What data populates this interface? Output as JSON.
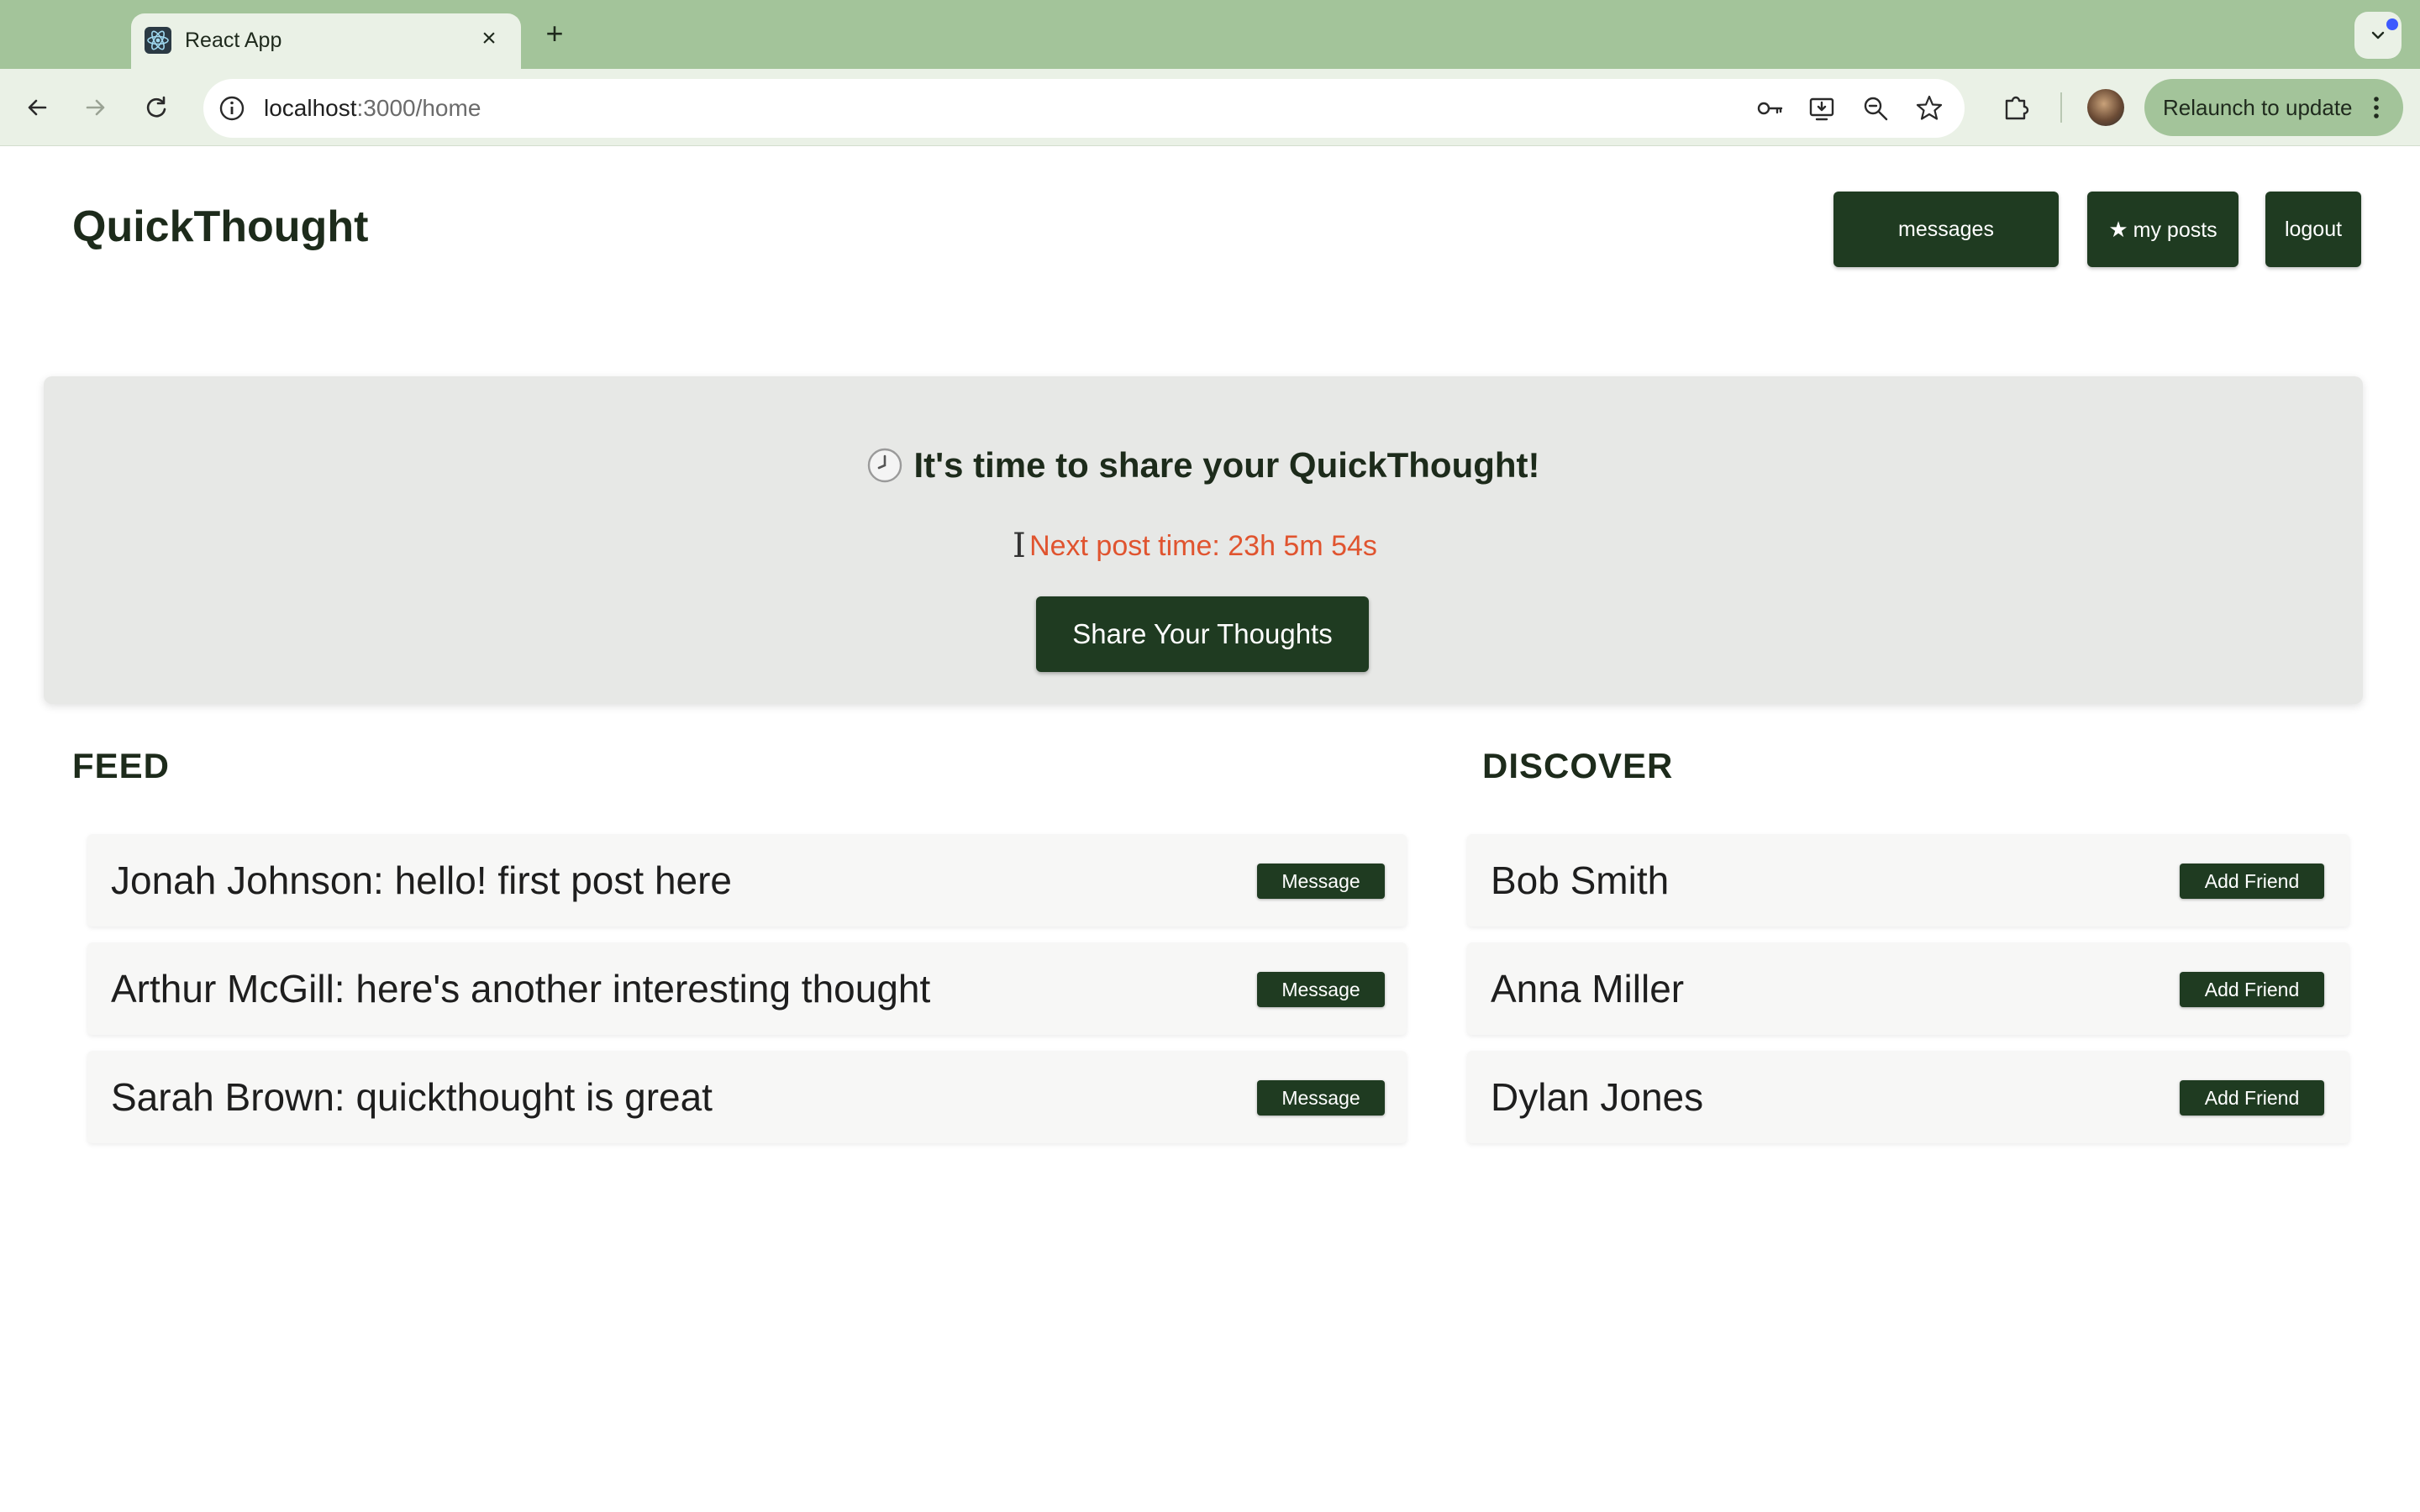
{
  "browser": {
    "tab_title": "React App",
    "url_host": "localhost",
    "url_path": ":3000/home",
    "relaunch_label": "Relaunch to update"
  },
  "app": {
    "title": "QuickThought",
    "nav": {
      "messages": "messages",
      "my_posts": "my posts",
      "logout": "logout"
    },
    "banner": {
      "title": "It's time to share your QuickThought!",
      "timer": "Next post time: 23h 5m 54s",
      "share_button": "Share Your Thoughts"
    },
    "feed": {
      "heading": "FEED",
      "items": [
        {
          "text": "Jonah Johnson: hello! first post here",
          "button": "Message"
        },
        {
          "text": "Arthur McGill: here's another interesting thought",
          "button": "Message"
        },
        {
          "text": "Sarah Brown: quickthought is great",
          "button": "Message"
        }
      ]
    },
    "discover": {
      "heading": "DISCOVER",
      "items": [
        {
          "name": "Bob Smith",
          "button": "Add Friend"
        },
        {
          "name": "Anna Miller",
          "button": "Add Friend"
        },
        {
          "name": "Dylan Jones",
          "button": "Add Friend"
        }
      ]
    }
  },
  "colors": {
    "accent": "#1f3b21",
    "timer": "#e0542f",
    "chrome": "#a3c49a"
  }
}
